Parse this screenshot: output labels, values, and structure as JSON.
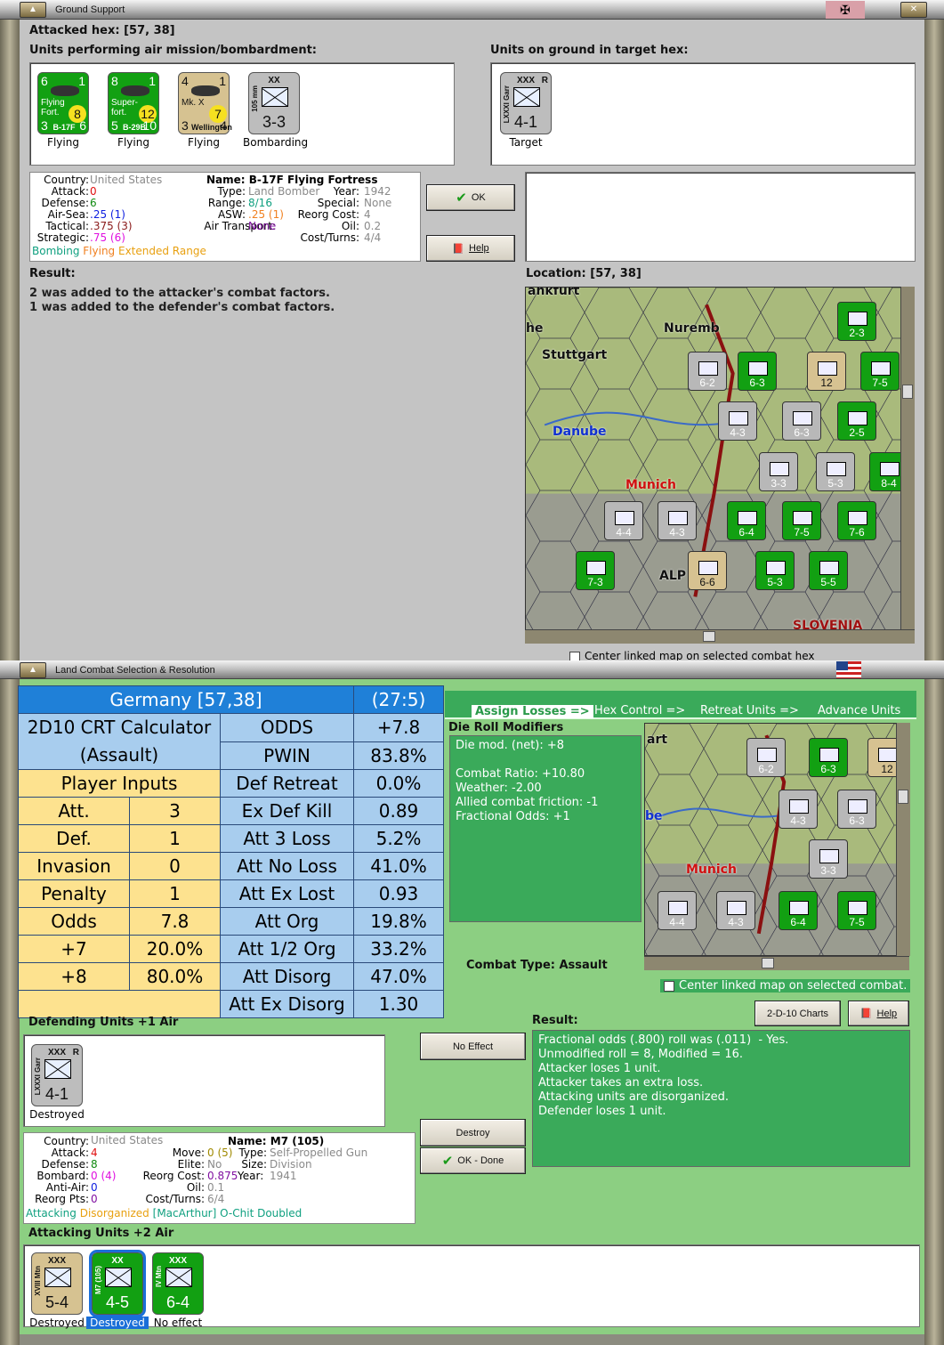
{
  "win1": {
    "title": "Ground Support",
    "attacked_hex": "Attacked hex:  [57, 38]",
    "air_label": "Units performing air mission/bombardment:",
    "ground_label": "Units on ground in target hex:",
    "air_units": [
      {
        "name": "B-17F",
        "desc": "Flying Fort.",
        "tl": "6",
        "tr": "1",
        "bl": "3",
        "br": "6",
        "badge": "8",
        "color": "#12a012",
        "status": "Flying"
      },
      {
        "name": "B-29B",
        "desc": "Super-fort.",
        "tl": "8",
        "tr": "1",
        "bl": "5",
        "br": "10",
        "badge": "12",
        "color": "#12a012",
        "status": "Flying"
      },
      {
        "name": "Wellington",
        "desc": "Mk. X",
        "tl": "4",
        "tr": "1",
        "bl": "3",
        "br": "4",
        "badge": "7",
        "color": "#d6c291",
        "status": "Flying"
      },
      {
        "name": "105 mm",
        "size": "XX",
        "value": "3-3",
        "color": "#bdbdbd",
        "status": "Bombarding"
      }
    ],
    "ground_units": [
      {
        "name": "LXXXI Garr",
        "size": "XXX",
        "flag": "R",
        "value": "4-1",
        "color": "#bdbdbd",
        "status": "Target"
      }
    ],
    "info": {
      "country_l": "Country:",
      "country": "United States",
      "attack_l": "Attack:",
      "attack": "0",
      "defense_l": "Defense:",
      "defense": "6",
      "airsea_l": "Air-Sea:",
      "airsea": ".25 (1)",
      "tactical_l": "Tactical:",
      "tactical": ".375 (3)",
      "strategic_l": "Strategic:",
      "strategic": ".75 (6)",
      "name": "Name: B-17F Flying Fortress",
      "type_l": "Type:",
      "type": "Land Bomber",
      "year_l": "Year:",
      "year": "1942",
      "range_l": "Range:",
      "range": "8/16",
      "special_l": "Special:",
      "special": "None",
      "asw_l": "ASW:",
      "asw": ".25 (1)",
      "reorg_l": "Reorg Cost:",
      "reorg": "4",
      "airtrans_l": "Air Transport:",
      "airtrans": "None",
      "oil_l": "Oil:",
      "oil": "0.2",
      "cost_l": "Cost/Turns:",
      "cost": "4/4",
      "tag1": "Bombing",
      "tag2": "Flying",
      "tag3": "Extended Range"
    },
    "ok": "OK",
    "help": "Help",
    "result_label": "Result:",
    "result_lines": [
      "2 was added to the attacker's combat factors.",
      "1 was added to the defender's combat factors."
    ],
    "location": "Location:   [57, 38]",
    "center_chk": "Center linked map on selected combat hex",
    "map": {
      "places": [
        "Nuremb",
        "Stuttgart",
        "Danube",
        "Munich",
        "ALP",
        "SLOVENIA",
        "ankfurt",
        "he"
      ],
      "counters": [
        {
          "v": "6-2",
          "c": "#b8b8b8"
        },
        {
          "v": "6-3",
          "c": "#12a012"
        },
        {
          "v": "12",
          "c": "#d6c291"
        },
        {
          "v": "7-5",
          "c": "#12a012"
        },
        {
          "v": "4-3",
          "c": "#b8b8b8"
        },
        {
          "v": "6-3",
          "c": "#b8b8b8"
        },
        {
          "v": "2-5",
          "c": "#12a012"
        },
        {
          "v": "3-3",
          "c": "#b8b8b8"
        },
        {
          "v": "5-3",
          "c": "#b8b8b8"
        },
        {
          "v": "8-4",
          "c": "#12a012"
        },
        {
          "v": "4-4",
          "c": "#b8b8b8"
        },
        {
          "v": "4-3",
          "c": "#b8b8b8"
        },
        {
          "v": "6-4",
          "c": "#12a012"
        },
        {
          "v": "7-5",
          "c": "#12a012"
        },
        {
          "v": "7-6",
          "c": "#12a012"
        },
        {
          "v": "7-3",
          "c": "#12a012"
        },
        {
          "v": "6-6",
          "c": "#d6c291"
        },
        {
          "v": "5-3",
          "c": "#12a012"
        },
        {
          "v": "5-5",
          "c": "#12a012"
        },
        {
          "v": "2-3",
          "c": "#12a012"
        }
      ]
    }
  },
  "win2": {
    "title": "Land Combat Selection & Resolution",
    "crt": {
      "hex": "Germany [57,38]",
      "ratio": "(27:5)",
      "calc1": "2D10 CRT Calculator",
      "calc2": "(Assault)",
      "player_inputs": "Player Inputs",
      "inputs": [
        [
          "Att.",
          "3"
        ],
        [
          "Def.",
          "1"
        ],
        [
          "Invasion",
          "0"
        ],
        [
          "Penalty",
          "1"
        ],
        [
          "Odds",
          "7.8"
        ],
        [
          "+7",
          "20.0%"
        ],
        [
          "+8",
          "80.0%"
        ]
      ],
      "results": [
        [
          "ODDS",
          "+7.8"
        ],
        [
          "PWIN",
          "83.8%"
        ],
        [
          "Def Retreat",
          "0.0%"
        ],
        [
          "Ex Def Kill",
          "0.89"
        ],
        [
          "Att 3 Loss",
          "5.2%"
        ],
        [
          "Att No Loss",
          "41.0%"
        ],
        [
          "Att Ex Lost",
          "0.93"
        ],
        [
          "Att Org",
          "19.8%"
        ],
        [
          "Att 1/2 Org",
          "33.2%"
        ],
        [
          "Att Disorg",
          "47.0%"
        ],
        [
          "Att Ex Disorg",
          "1.30"
        ]
      ]
    },
    "tabs": [
      "Assign Losses =>",
      "Hex Control =>",
      "Retreat Units =>",
      "Advance Units"
    ],
    "drm_label": "Die Roll Modifiers",
    "drm": "Die mod. (net): +8\n\nCombat Ratio: +10.80\nWeather: -2.00\nAllied combat friction: -1\nFractional Odds: +1",
    "combat_type": "Combat Type:  Assault",
    "center_chk": "Center linked map on selected combat.",
    "charts": "2-D-10 Charts",
    "help": "Help",
    "result_label": "Result:",
    "result": "Fractional odds (.800) roll was (.011)  - Yes.\nUnmodified roll = 8, Modified = 16.\nAttacker loses 1 unit.\nAttacker takes an extra loss.\nAttacking units are disorganized.\nDefender loses 1 unit.",
    "def_label": "Defending Units +1 Air",
    "def_units": [
      {
        "name": "LXXXI Garr",
        "size": "XXX",
        "flag": "R",
        "value": "4-1",
        "color": "#bdbdbd",
        "status": "Destroyed"
      }
    ],
    "no_effect": "No Effect",
    "destroy": "Destroy",
    "ok_done": "OK - Done",
    "info": {
      "country_l": "Country:",
      "country": "United States",
      "attack_l": "Attack:",
      "attack": "4",
      "defense_l": "Defense:",
      "defense": "8",
      "bombard_l": "Bombard:",
      "bombard": "0 (4)",
      "aa_l": "Anti-Air:",
      "aa": "0",
      "rpts_l": "Reorg Pts:",
      "rpts": "0",
      "name": "Name: M7 (105)",
      "move_l": "Move:",
      "move": "0 (5)",
      "type_l": "Type:",
      "type": "Self-Propelled Gun",
      "elite_l": "Elite:",
      "elite": "No",
      "size_l": "Size:",
      "size": "Division",
      "reorg_l": "Reorg Cost:",
      "reorg": "0.875",
      "year_l": "Year:",
      "year": "1941",
      "oil_l": "Oil:",
      "oil": "0.1",
      "cost_l": "Cost/Turns:",
      "cost": "6/4",
      "tag1": "Attacking",
      "tag2": "Disorganized",
      "tag3": "[MacArthur]",
      "tag4": "O-Chit Doubled"
    },
    "att_label": "Attacking Units +2 Air",
    "att_units": [
      {
        "name": "XVIII Mtn",
        "size": "XXX",
        "value": "5-4",
        "color": "#d6c291",
        "status": "Destroyed"
      },
      {
        "name": "M7 (105)",
        "size": "XX",
        "value": "4-5",
        "color": "#12a012",
        "status": "Destroyed"
      },
      {
        "name": "IV Mtn",
        "size": "XXX",
        "value": "6-4",
        "color": "#12a012",
        "status": "No effect"
      }
    ],
    "mini_map": {
      "places": [
        "art",
        "be",
        "Munich"
      ],
      "counters": [
        {
          "v": "6-2",
          "c": "#b8b8b8"
        },
        {
          "v": "6-3",
          "c": "#12a012"
        },
        {
          "v": "12",
          "c": "#d6c291"
        },
        {
          "v": "4-3",
          "c": "#b8b8b8"
        },
        {
          "v": "6-3",
          "c": "#b8b8b8"
        },
        {
          "v": "3-3",
          "c": "#b8b8b8"
        },
        {
          "v": "4-4",
          "c": "#b8b8b8"
        },
        {
          "v": "4-3",
          "c": "#b8b8b8"
        },
        {
          "v": "6-4",
          "c": "#12a012"
        },
        {
          "v": "7-5",
          "c": "#12a012"
        }
      ]
    }
  }
}
